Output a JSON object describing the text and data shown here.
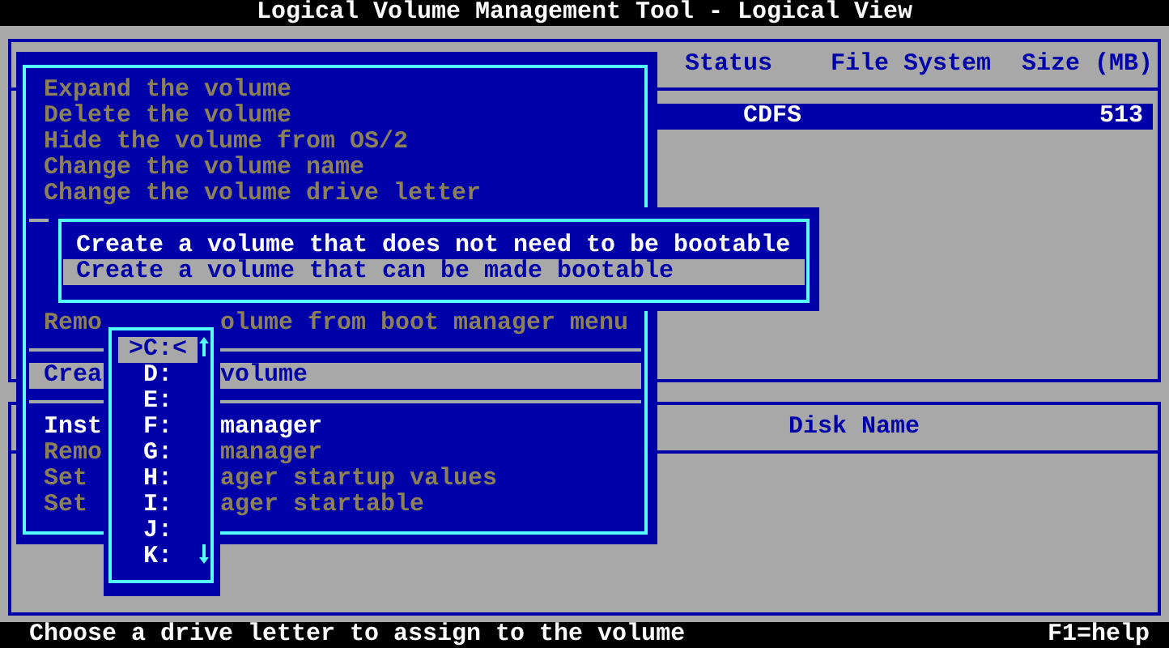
{
  "window": {
    "title": "Logical Volume Management Tool - Logical View"
  },
  "volume_table": {
    "columns": [
      "Status",
      "File System",
      "Size (MB)"
    ],
    "rows": [
      {
        "selected": true,
        "file_system": "CDFS",
        "size": "513"
      }
    ]
  },
  "disk_table": {
    "columns": [
      "Disk Name"
    ]
  },
  "volume_menu": {
    "upper_items": [
      {
        "kind": "item",
        "left": "Expand the volume",
        "disabled": true,
        "selected": false
      },
      {
        "kind": "item",
        "left": "Delete the volume",
        "disabled": true,
        "selected": false
      },
      {
        "kind": "item",
        "left": "Hide the volume from OS/2",
        "disabled": true,
        "selected": false
      },
      {
        "kind": "item",
        "left": "Change the volume name",
        "disabled": true,
        "selected": false
      },
      {
        "kind": "item",
        "left": "Change the volume drive letter",
        "disabled": true,
        "selected": false
      },
      {
        "kind": "separator"
      }
    ],
    "lower_items": [
      {
        "kind": "item",
        "left": "Remo",
        "right": "olume from boot manager menu",
        "disabled": true,
        "selected": false
      },
      {
        "kind": "separator"
      },
      {
        "kind": "item",
        "left": "Crea",
        "right": "volume",
        "disabled": false,
        "selected": true
      },
      {
        "kind": "separator"
      },
      {
        "kind": "item",
        "left": "Inst",
        "right": "manager",
        "disabled": false,
        "selected": false
      },
      {
        "kind": "item",
        "left": "Remo",
        "right": "manager",
        "disabled": true,
        "selected": false
      },
      {
        "kind": "item",
        "left": "Set",
        "right": "ager startup values",
        "disabled": true,
        "selected": false
      },
      {
        "kind": "item",
        "left": "Set",
        "right": "ager startable",
        "disabled": true,
        "selected": false
      }
    ]
  },
  "create_menu": {
    "items": [
      {
        "label": "Create a volume that does not need to be bootable",
        "selected": false
      },
      {
        "label": "Create a volume that can be made bootable",
        "selected": true
      }
    ]
  },
  "drive_letters": {
    "items": [
      {
        "label": ">C:<",
        "selected": true
      },
      {
        "label": "D:",
        "selected": false
      },
      {
        "label": "E:",
        "selected": false
      },
      {
        "label": "F:",
        "selected": false
      },
      {
        "label": "G:",
        "selected": false
      },
      {
        "label": "H:",
        "selected": false
      },
      {
        "label": "I:",
        "selected": false
      },
      {
        "label": "J:",
        "selected": false
      },
      {
        "label": "K:",
        "selected": false
      }
    ]
  },
  "status_bar": {
    "message": "Choose a drive letter to assign to the volume",
    "help": "F1=help"
  }
}
